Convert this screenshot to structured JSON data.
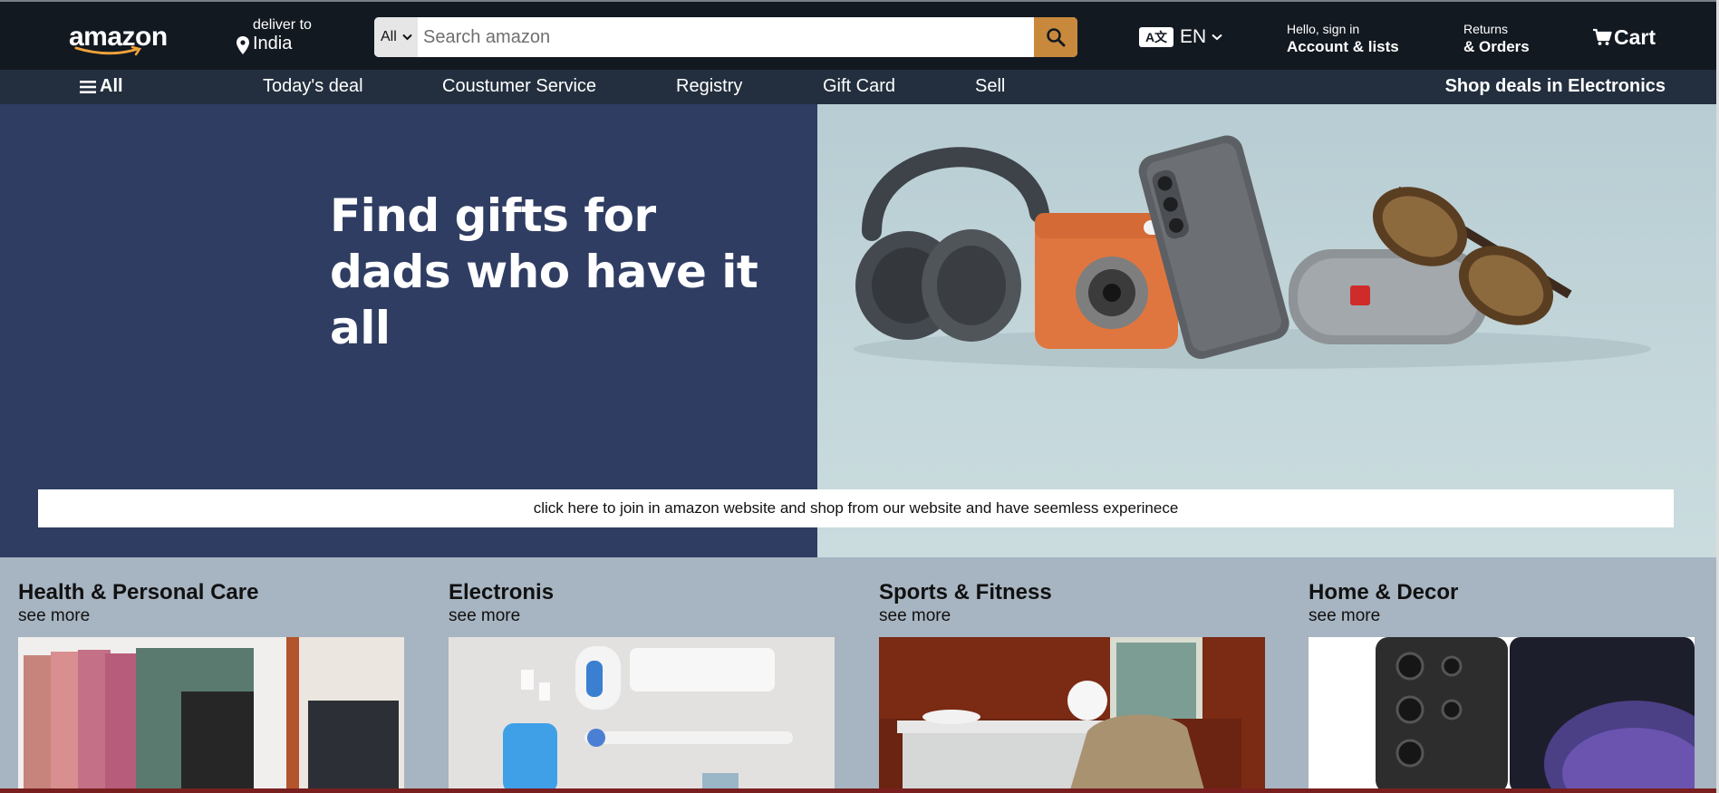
{
  "header": {
    "logo": "amazon",
    "deliver_label": "deliver to",
    "deliver_location": "India",
    "search": {
      "category": "All",
      "placeholder": "Search amazon"
    },
    "language": {
      "icon_text": "A文",
      "code": "EN"
    },
    "account": {
      "line1": "Hello, sign in",
      "line2": "Account & lists"
    },
    "orders": {
      "line1": "Returns",
      "line2": "& Orders"
    },
    "cart": {
      "label": "Cart"
    }
  },
  "subnav": {
    "all_label": "All",
    "items": [
      "Today's deal",
      "Coustumer Service",
      "Registry",
      "Gift Card",
      "Sell"
    ],
    "promo": "Shop deals in Electronics"
  },
  "hero": {
    "title_line1": "Find gifts for",
    "title_line2": "dads who have it all",
    "banner_text": "click here to join in amazon website and shop from our website and have seemless experinece"
  },
  "categories": [
    {
      "title": "Health & Personal Care",
      "link": "see more"
    },
    {
      "title": "Electronis",
      "link": "see more"
    },
    {
      "title": "Sports & Fitness",
      "link": "see more"
    },
    {
      "title": "Home & Decor",
      "link": "see more"
    }
  ],
  "icons": {
    "search": "search-icon",
    "pin": "location-pin-icon",
    "cart": "cart-icon",
    "menu": "hamburger-menu-icon",
    "chevron": "chevron-down-icon"
  },
  "colors": {
    "header_bg": "#131921",
    "subnav_bg": "#232f3e",
    "search_button": "#c9893c",
    "hero_left": "#2f3d63",
    "cards_bg": "#a7b4c1"
  }
}
